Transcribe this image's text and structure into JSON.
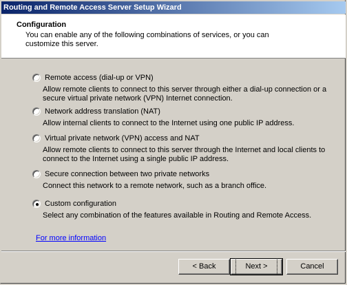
{
  "window": {
    "title": "Routing and Remote Access Server Setup Wizard"
  },
  "header": {
    "title": "Configuration",
    "subtitle": "You can enable any of the following combinations of services, or you can customize this server."
  },
  "options": [
    {
      "label": "Remote access (dial-up or VPN)",
      "description": "Allow remote clients to connect to this server through either a dial-up connection or a secure virtual private network (VPN) Internet connection.",
      "checked": false
    },
    {
      "label": "Network address translation (NAT)",
      "description": "Allow internal clients to connect to the Internet using one public IP address.",
      "checked": false
    },
    {
      "label": "Virtual private network (VPN) access and NAT",
      "description": "Allow remote clients to connect to this server through the Internet and local clients to connect to the Internet using a single public IP address.",
      "checked": false
    },
    {
      "label": "Secure connection between two private networks",
      "description": "Connect this network to a remote network, such as a branch office.",
      "checked": false
    },
    {
      "label": "Custom configuration",
      "description": "Select any combination of the features available in Routing and Remote Access.",
      "checked": true
    }
  ],
  "link": {
    "label": "For more information"
  },
  "buttons": {
    "back": "< Back",
    "next": "Next >",
    "cancel": "Cancel"
  }
}
